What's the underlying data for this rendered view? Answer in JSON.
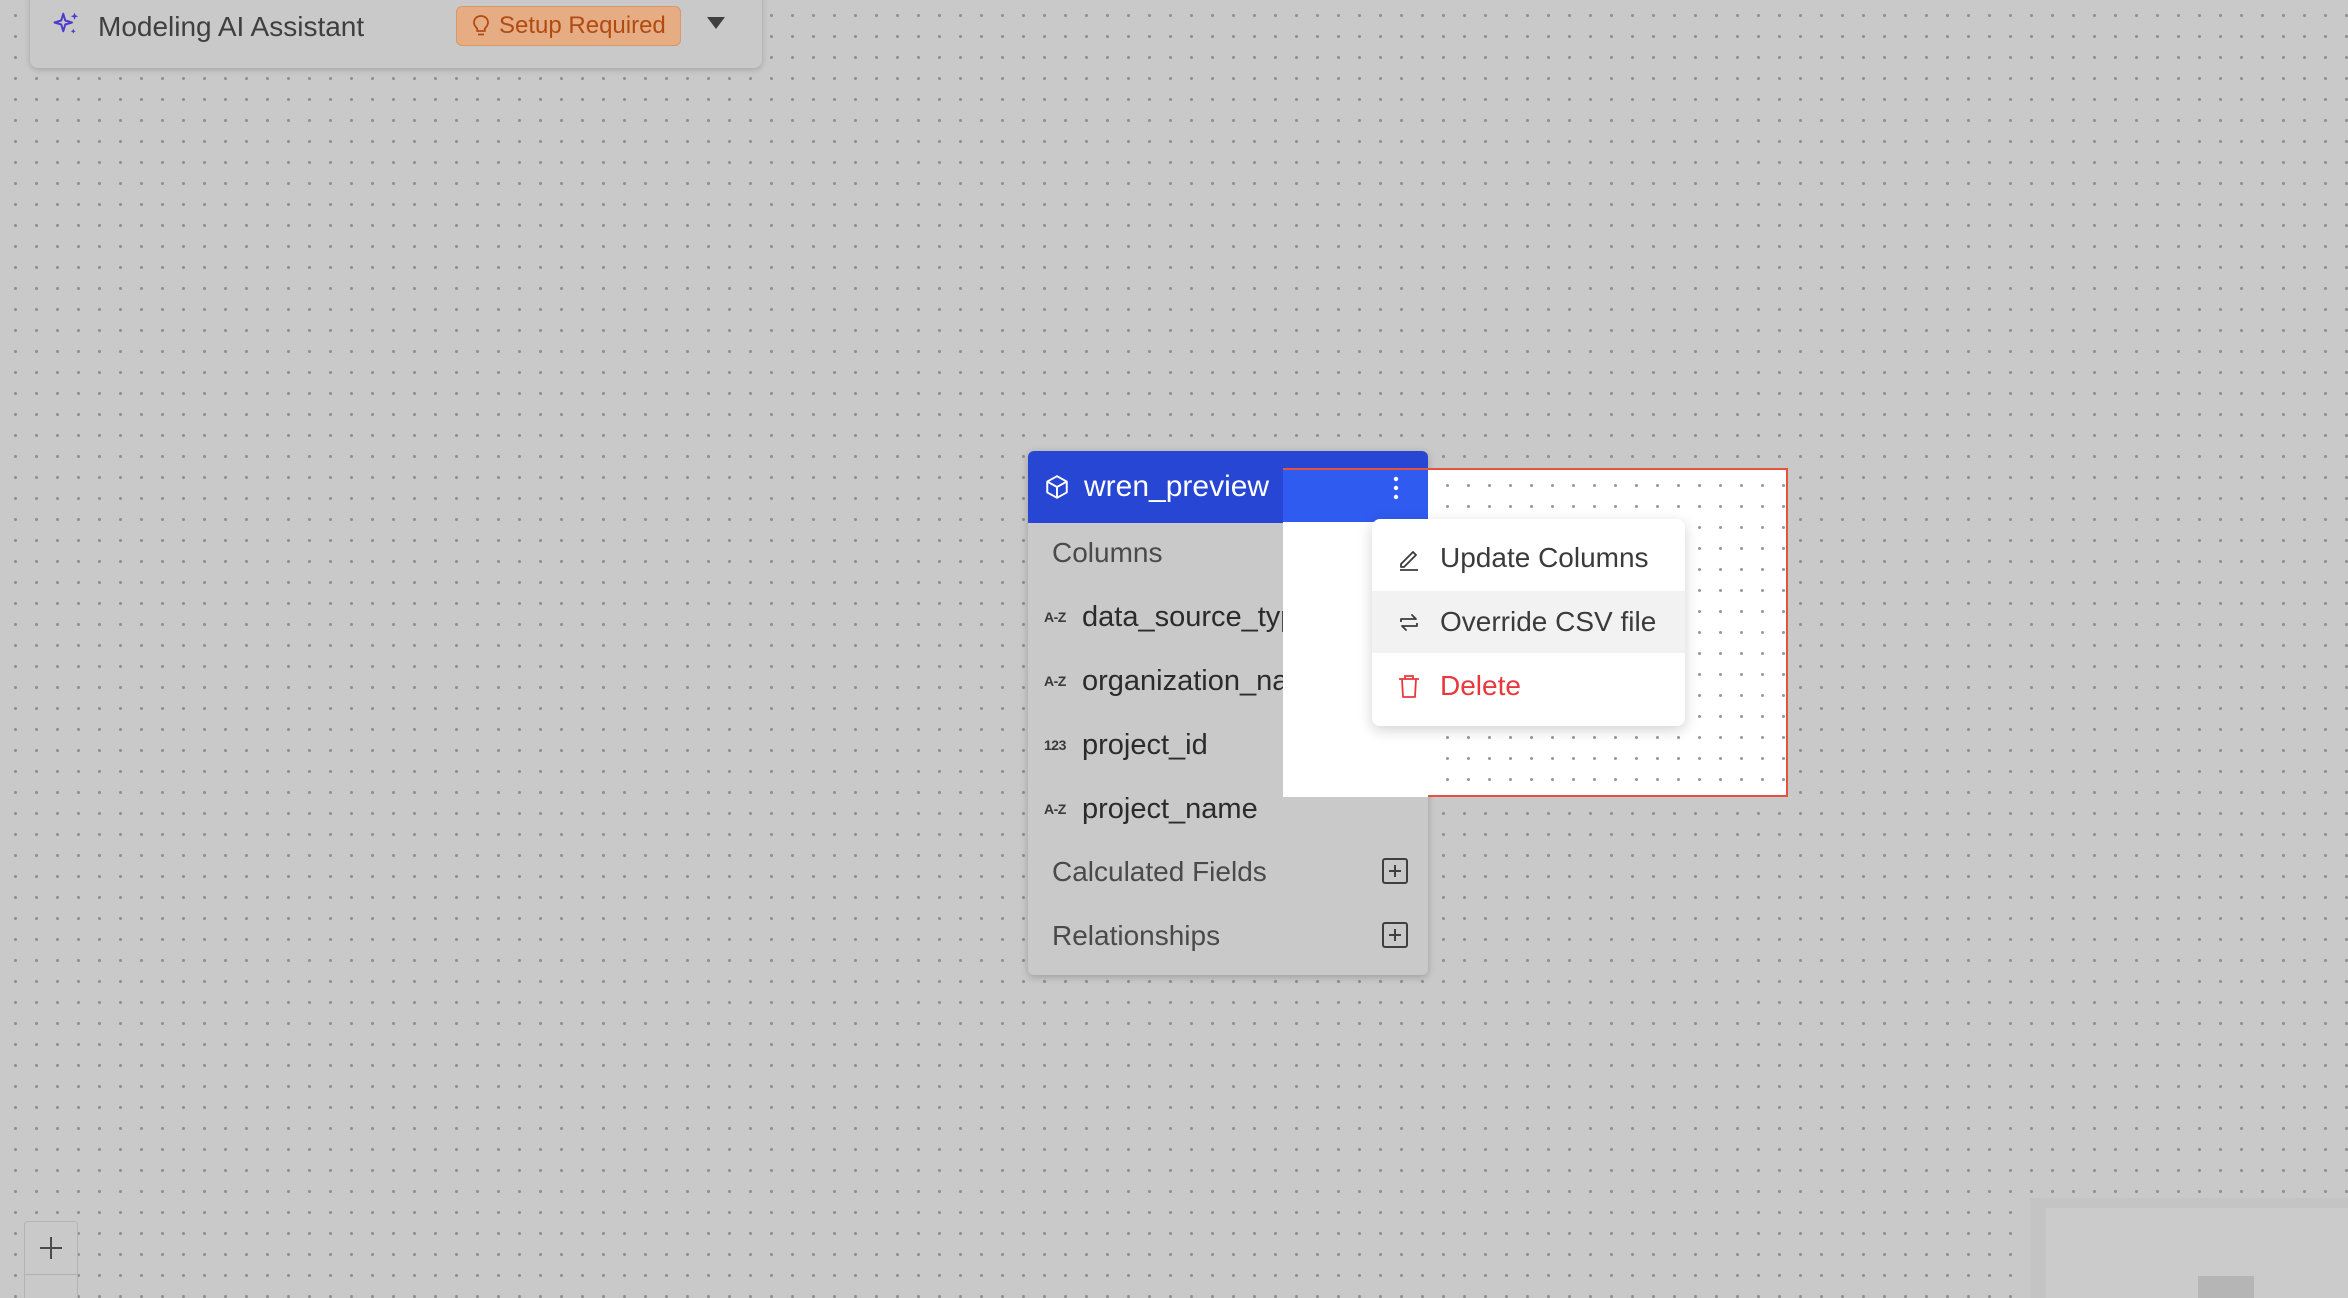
{
  "assistant": {
    "title": "Modeling AI Assistant",
    "badge": "Setup Required",
    "icon": "sparkle-icon"
  },
  "model": {
    "name": "wren_preview",
    "icon": "cube-icon",
    "columns_label": "Columns",
    "columns": [
      {
        "type": "A-Z",
        "name": "data_source_type"
      },
      {
        "type": "A-Z",
        "name": "organization_name"
      },
      {
        "type": "123",
        "name": "project_id"
      },
      {
        "type": "A-Z",
        "name": "project_name"
      }
    ],
    "calculated_fields_label": "Calculated Fields",
    "relationships_label": "Relationships"
  },
  "menu": {
    "items": [
      {
        "label": "Update Columns",
        "icon": "edit-icon"
      },
      {
        "label": "Override CSV file",
        "icon": "swap-icon"
      },
      {
        "label": "Delete",
        "icon": "trash-icon"
      }
    ]
  },
  "colors": {
    "canvas": "#c9c9c9",
    "header_blue": "#2746d4",
    "danger": "#e8383d",
    "badge_bg": "#e6ad84",
    "badge_text": "#b14b12",
    "selection_border": "#e5533c"
  }
}
